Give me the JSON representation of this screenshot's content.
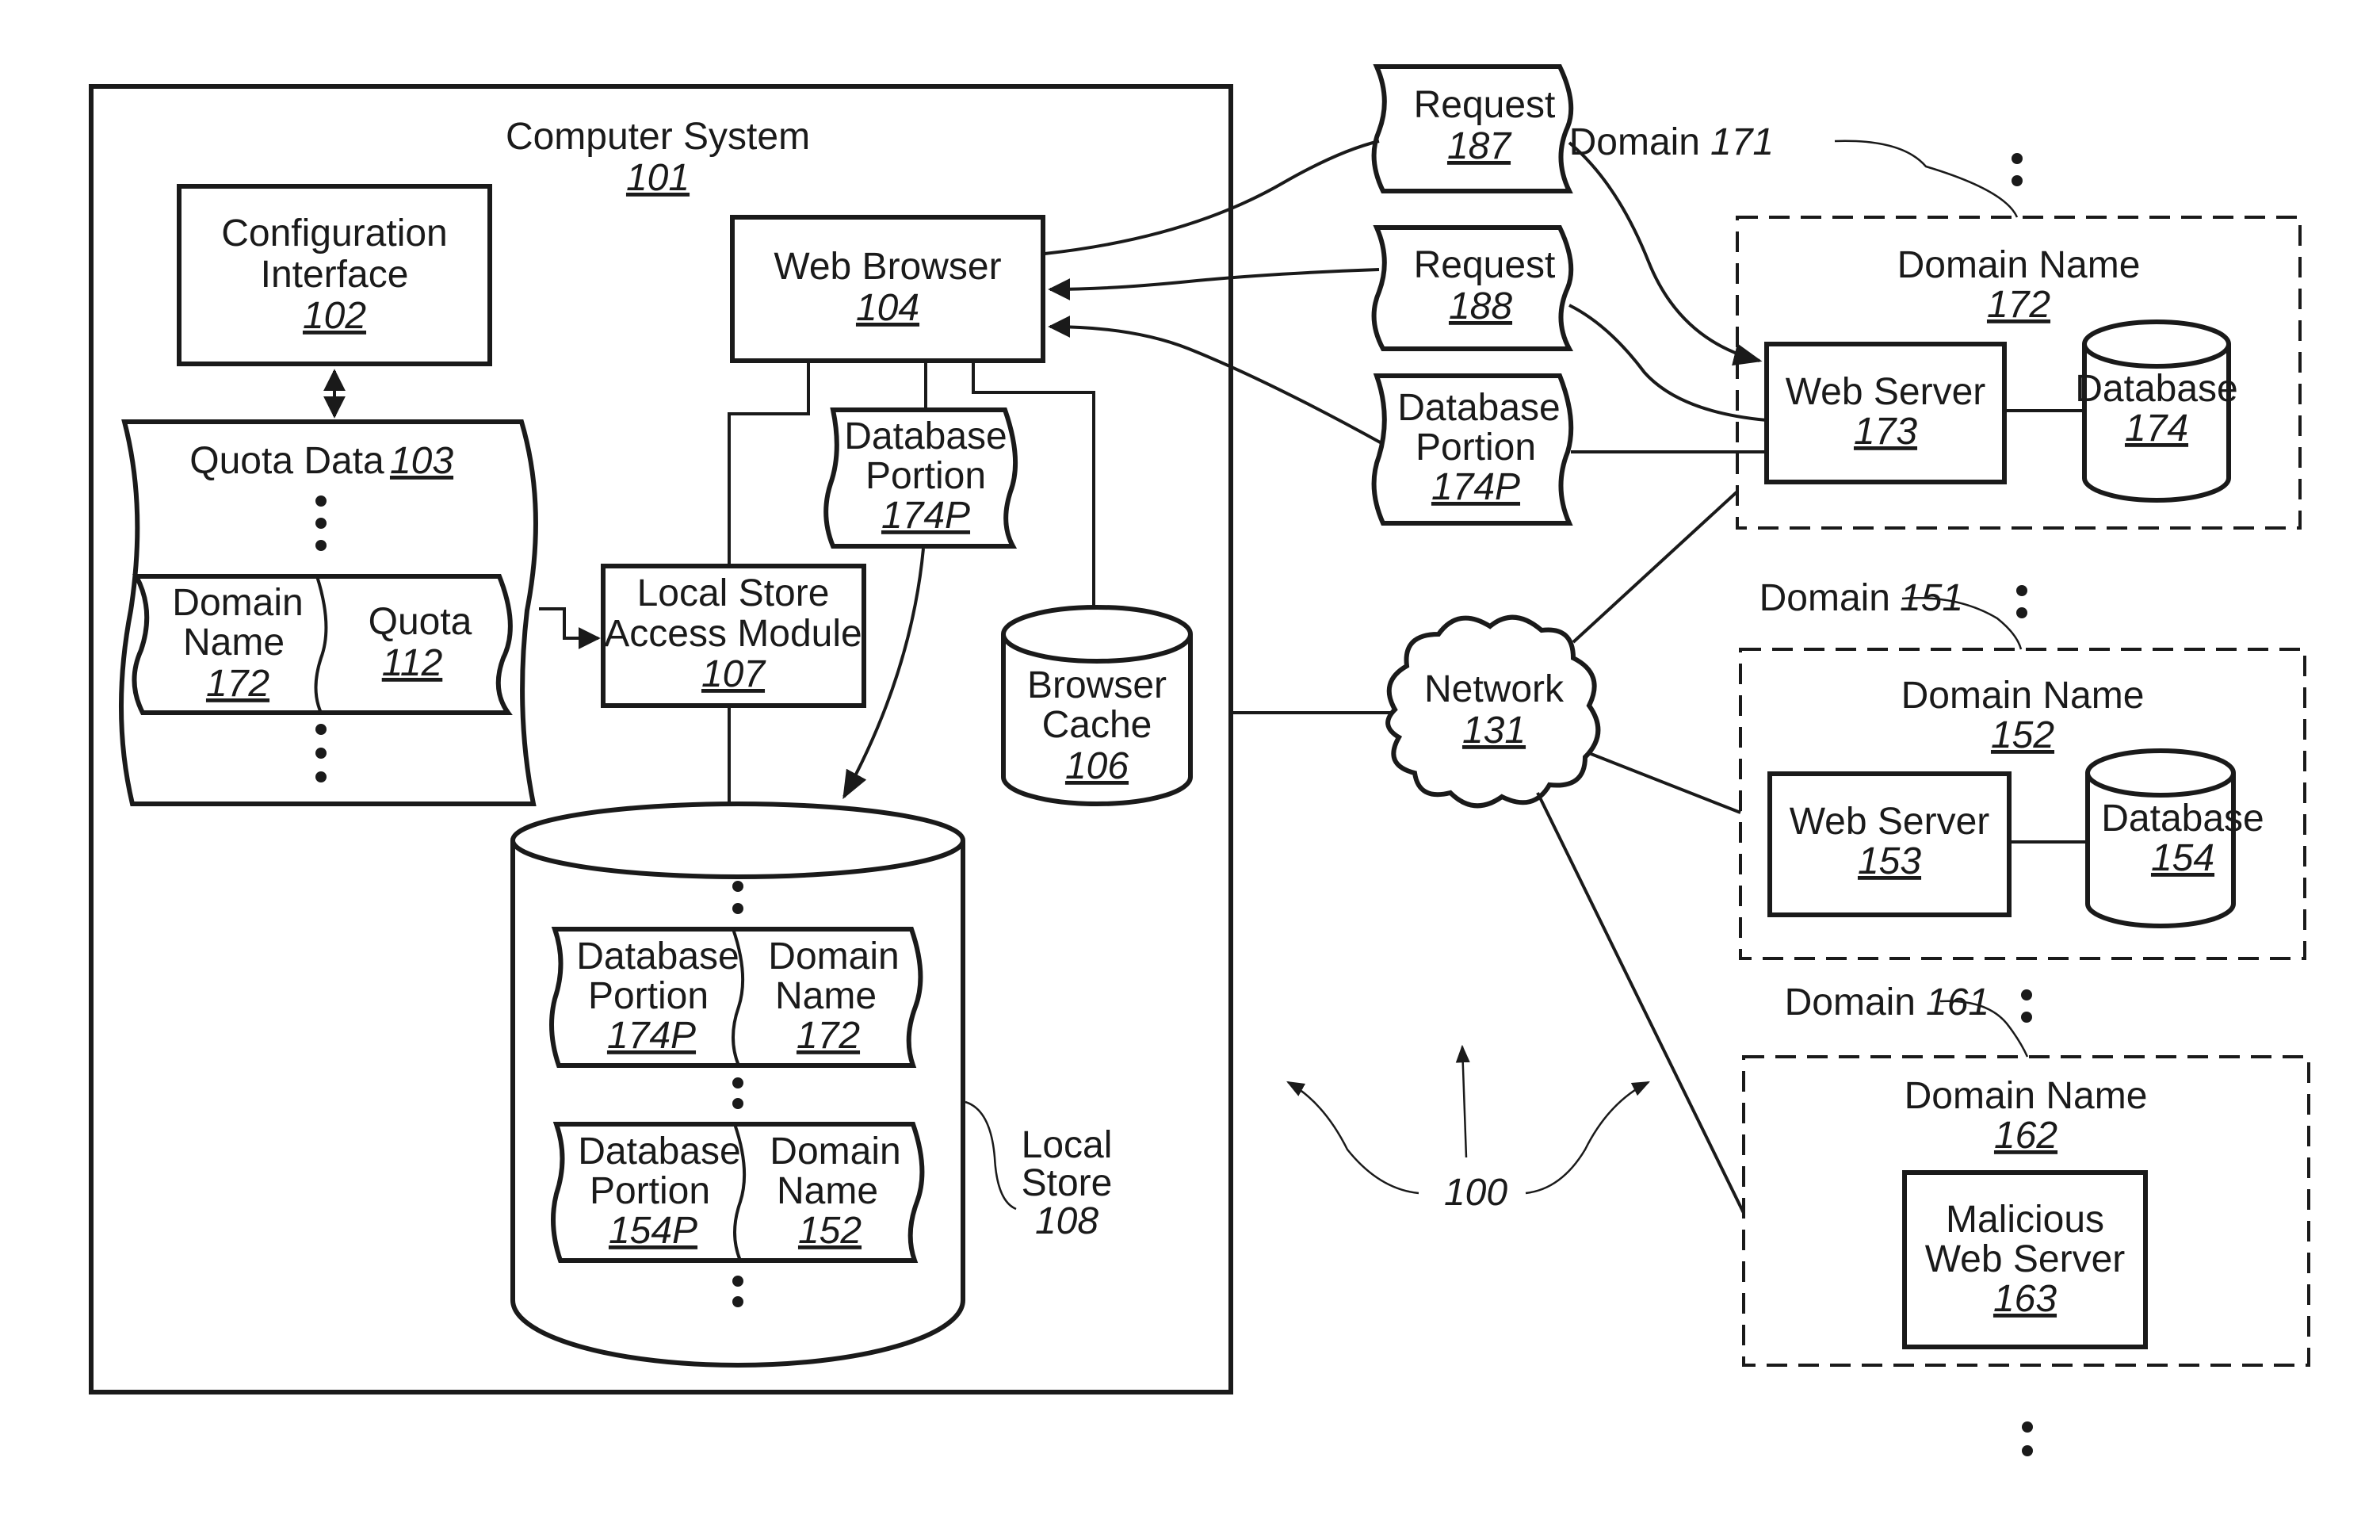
{
  "figure": {
    "reference": "100"
  },
  "computer_system": {
    "title": "Computer System",
    "ref": "101",
    "configuration_interface": {
      "line1": "Configuration",
      "line2": "Interface",
      "ref": "102"
    },
    "quota_data": {
      "title": "Quota Data",
      "ref": "103",
      "entry": {
        "domain_line1": "Domain",
        "domain_line2": "Name",
        "domain_ref": "172",
        "quota_label": "Quota",
        "quota_ref": "112"
      }
    },
    "web_browser": {
      "title": "Web Browser",
      "ref": "104"
    },
    "database_portion": {
      "line1": "Database",
      "line2": "Portion",
      "ref": "174P"
    },
    "local_store_access_module": {
      "line1": "Local Store",
      "line2": "Access Module",
      "ref": "107"
    },
    "browser_cache": {
      "line1": "Browser",
      "line2": "Cache",
      "ref": "106"
    },
    "local_store": {
      "label_line1": "Local",
      "label_line2": "Store",
      "ref": "108",
      "entries": [
        {
          "portion_line1": "Database",
          "portion_line2": "Portion",
          "portion_ref": "174P",
          "domain_line1": "Domain",
          "domain_line2": "Name",
          "domain_ref": "172"
        },
        {
          "portion_line1": "Database",
          "portion_line2": "Portion",
          "portion_ref": "154P",
          "domain_line1": "Domain",
          "domain_line2": "Name",
          "domain_ref": "152"
        }
      ]
    }
  },
  "messages": [
    {
      "label": "Request",
      "ref": "187"
    },
    {
      "label": "Request",
      "ref": "188"
    },
    {
      "line1": "Database",
      "line2": "Portion",
      "ref": "174P"
    }
  ],
  "network": {
    "label": "Network",
    "ref": "131"
  },
  "domains": [
    {
      "label": "Domain",
      "ref": "171",
      "domain_name": "Domain Name",
      "domain_name_ref": "172",
      "web_server": {
        "label": "Web Server",
        "ref": "173"
      },
      "database": {
        "label": "Database",
        "ref": "174"
      }
    },
    {
      "label": "Domain",
      "ref": "151",
      "domain_name": "Domain Name",
      "domain_name_ref": "152",
      "web_server": {
        "label": "Web Server",
        "ref": "153"
      },
      "database": {
        "label": "Database",
        "ref": "154"
      }
    },
    {
      "label": "Domain",
      "ref": "161",
      "domain_name": "Domain Name",
      "domain_name_ref": "162",
      "malicious_server": {
        "line1": "Malicious",
        "line2": "Web Server",
        "ref": "163"
      }
    }
  ]
}
